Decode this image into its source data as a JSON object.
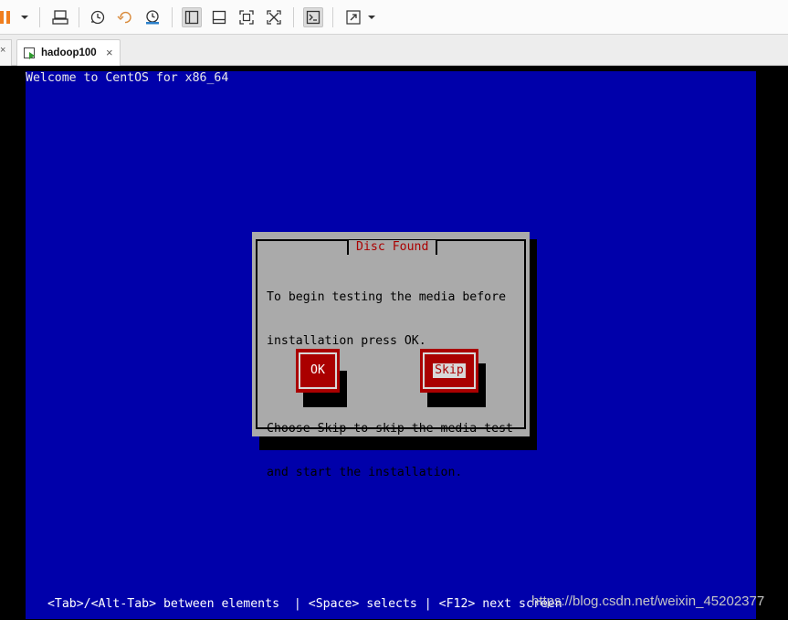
{
  "tab": {
    "label": "hadoop100",
    "close": "×"
  },
  "left_tab_close": "×",
  "toolbar": {
    "icons": [
      "pause-icon",
      "send-keys-icon",
      "snapshot-icon",
      "revert-snapshot-icon",
      "snapshot-manager-icon",
      "library-view-icon",
      "thumbnail-view-icon",
      "fullscreen-icon",
      "unity-icon",
      "console-icon",
      "stretch-icon"
    ]
  },
  "console": {
    "title": "Welcome to CentOS for x86_64",
    "status_bar": " <Tab>/<Alt-Tab> between elements  | <Space> selects | <F12> next screen"
  },
  "dialog": {
    "title": "Disc Found",
    "line1": "To begin testing the media before",
    "line2": "installation press OK.",
    "line3": "Choose Skip to skip the media test",
    "line4": "and start the installation.",
    "ok_label": "OK",
    "skip_label": "Skip"
  },
  "watermark": "https://blog.csdn.net/weixin_45202377",
  "colors": {
    "console_bg": "#0000aa",
    "dialog_bg": "#aaaaaa",
    "button_bg": "#aa0000",
    "title_red": "#aa0000",
    "pause_orange": "#f07e1e"
  }
}
